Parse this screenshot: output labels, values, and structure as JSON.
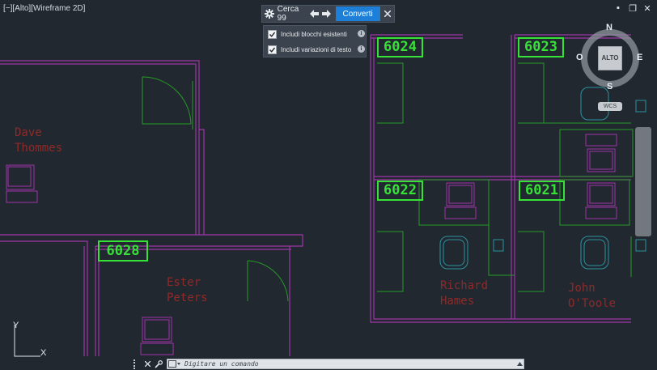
{
  "viewport": {
    "label": "[−][Alto][Wireframe 2D]"
  },
  "window_controls": {
    "minimize": "▪",
    "restore": "❐",
    "close": "✕"
  },
  "find_replace": {
    "search_text": "Cerca 99",
    "convert_label": "Converti"
  },
  "options": [
    {
      "label": "Includi blocchi esistenti",
      "checked": true
    },
    {
      "label": "Includi variazioni di testo",
      "checked": true
    }
  ],
  "viewcube": {
    "north": "N",
    "south": "S",
    "east": "E",
    "west": "O",
    "face": "ALTO",
    "ucs": "WCS"
  },
  "rooms": [
    "6024",
    "6023",
    "6022",
    "6021",
    "6028"
  ],
  "occupants": [
    {
      "line1": "Dave",
      "line2": "Thommes"
    },
    {
      "line1": "Ester",
      "line2": "Peters"
    },
    {
      "line1": "Richard",
      "line2": "Hames"
    },
    {
      "line1": "John",
      "line2": "O'Toole"
    }
  ],
  "ucs_icon": {
    "x": "X",
    "y": "Y"
  },
  "command_line": {
    "placeholder": "Digitare un comando"
  },
  "colors": {
    "background": "#212830",
    "wall": "#b43bb4",
    "furniture": "#2aa22a",
    "chair": "#2a9aa8",
    "label": "#37e137",
    "name": "#8f2a2a",
    "accent": "#1d7fd8"
  }
}
